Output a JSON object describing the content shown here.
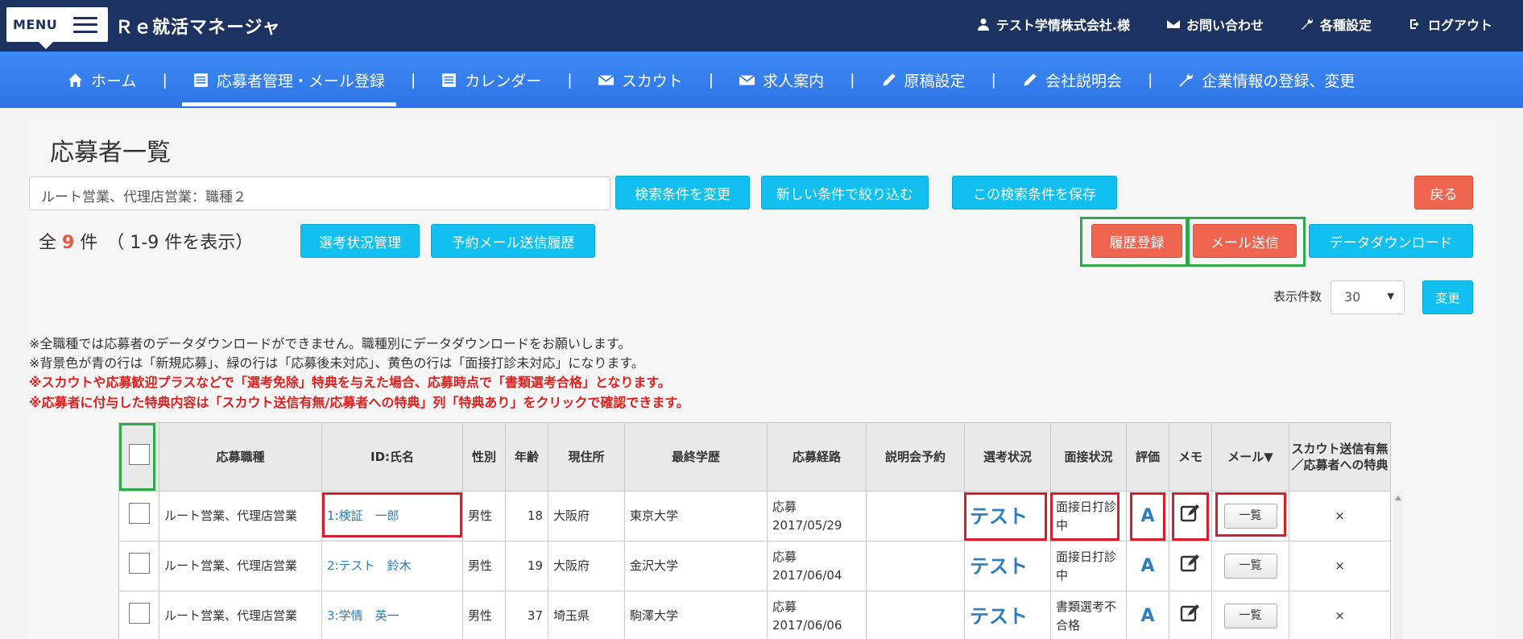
{
  "header": {
    "menu_label": "MENU",
    "app_title": "Ｒｅ就活マネージャ",
    "user": "テスト学情株式会社.様",
    "contact": "お問い合わせ",
    "settings": "各種設定",
    "logout": "ログアウト"
  },
  "nav": {
    "home": "ホーム",
    "applicants": "応募者管理・メール登録",
    "calendar": "カレンダー",
    "scout": "スカウト",
    "jobs": "求人案内",
    "manuscript": "原稿設定",
    "briefing": "会社説明会",
    "company": "企業情報の登録、変更",
    "sep": "|"
  },
  "page": {
    "title": "応募者一覧",
    "search_value": "ルート営業、代理店営業：職種２",
    "btn_change_cond": "検索条件を変更",
    "btn_new_filter": "新しい条件で絞り込む",
    "btn_save_cond": "この検索条件を保存",
    "btn_back": "戻る",
    "count_prefix": "全",
    "count_num": "9",
    "count_suffix": "件　（ 1-9 件を表示）",
    "btn_status_mgmt": "選考状況管理",
    "btn_reserve_history": "予約メール送信履歴",
    "btn_history_reg": "履歴登録",
    "btn_send_mail": "メール送信",
    "btn_download": "データダウンロード",
    "perpage_label": "表示件数",
    "perpage_value": "30",
    "perpage_caret": "▼",
    "btn_change": "変更"
  },
  "notes": [
    "※全職種では応募者のデータダウンロードができません。職種別にデータダウンロードをお願いします。",
    "※背景色が青の行は「新規応募」、緑の行は「応募後未対応」、黄色の行は「面接打診未対応」になります。",
    "※スカウトや応募歓迎プラスなどで「選考免除」特典を与えた場合、応募時点で「書類選考合格」となります。",
    "※応募者に付与した特典内容は「スカウト送信有無/応募者への特典」列「特典あり」をクリックで確認できます。"
  ],
  "table": {
    "headers": [
      "応募職種",
      "ID:氏名",
      "性別",
      "年齢",
      "現住所",
      "最終学歴",
      "応募経路",
      "説明会予約",
      "選考状況",
      "面接状況",
      "評価",
      "メモ",
      "メール▼",
      "スカウト送信有無／応募者への特典"
    ],
    "rows": [
      {
        "job": "ルート営業、代理店営業",
        "name": "1:検証　一郎",
        "gender": "男性",
        "age": "18",
        "address": "大阪府",
        "school": "東京大学",
        "route": "応募",
        "date": "2017/05/29",
        "briefing": "",
        "status": "テスト",
        "interview": "面接日打診中",
        "grade": "A",
        "mail": "一覧",
        "scout": "×"
      },
      {
        "job": "ルート営業、代理店営業",
        "name": "2:テスト　鈴木",
        "gender": "男性",
        "age": "19",
        "address": "大阪府",
        "school": "金沢大学",
        "route": "応募",
        "date": "2017/06/04",
        "briefing": "",
        "status": "テスト",
        "interview": "面接日打診中",
        "grade": "A",
        "mail": "一覧",
        "scout": "×"
      },
      {
        "job": "ルート営業、代理店営業",
        "name": "3:学情　英一",
        "gender": "男性",
        "age": "37",
        "address": "埼玉県",
        "school": "駒澤大学",
        "route": "応募",
        "date": "2017/06/06",
        "briefing": "",
        "status": "テスト",
        "interview": "書類選考不合格",
        "grade": "A",
        "mail": "一覧",
        "scout": "×"
      }
    ]
  },
  "colors": {
    "topbar": "#1c3260",
    "navbar": "#2e73e8",
    "cyan": "#11bff0",
    "red": "#f0654f",
    "highlight_green": "#2daa4a",
    "highlight_red": "#d81e2c",
    "link": "#2b7fbf"
  },
  "icons": [
    "user-icon",
    "mail-icon",
    "wrench-icon",
    "logout-icon",
    "home-icon",
    "list-icon",
    "calendar-icon",
    "pencil-icon",
    "memo-icon"
  ]
}
